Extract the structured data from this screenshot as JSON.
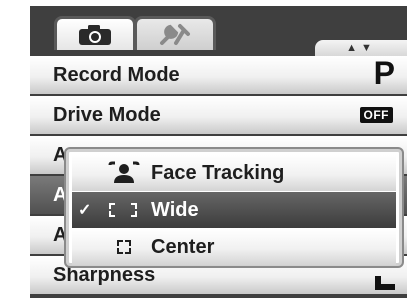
{
  "tabs": [
    {
      "icon": "camera-icon",
      "active": true
    },
    {
      "icon": "tools-icon",
      "active": false
    }
  ],
  "scroll_indicator": {
    "up": "▲",
    "down": "▼"
  },
  "menu": {
    "items": [
      {
        "label": "Record Mode",
        "value": "P"
      },
      {
        "label": "Drive Mode",
        "value": "OFF"
      },
      {
        "label": "A"
      },
      {
        "label": "A"
      },
      {
        "label": "A"
      },
      {
        "label": "Sharpness",
        "value_icon": "sharpness-normal-icon"
      }
    ]
  },
  "submenu": {
    "options": [
      {
        "label": "Face Tracking",
        "icon": "face-tracking-icon",
        "selected": false
      },
      {
        "label": "Wide",
        "icon": "wide-af-icon",
        "selected": true,
        "check": "✓"
      },
      {
        "label": "Center",
        "icon": "center-af-icon",
        "selected": false
      }
    ]
  },
  "colors": {
    "screen_bg": "#3f3f3f",
    "row_bg": "#ffffff",
    "selected_bg": "#505050",
    "text": "#1e1e1e"
  }
}
